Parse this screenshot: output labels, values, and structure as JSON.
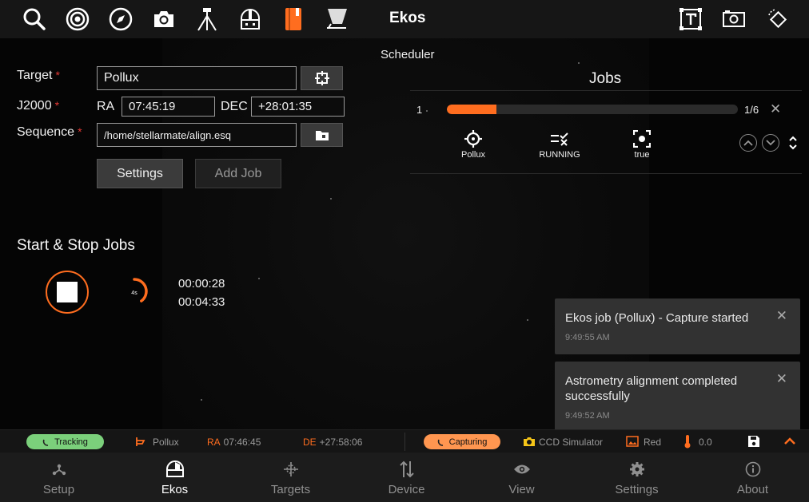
{
  "topbar": {
    "title": "Ekos",
    "icons": [
      "search-icon",
      "target-icon",
      "compass-icon",
      "camera-icon",
      "tripod-icon",
      "observatory-icon",
      "notebook-icon",
      "flat-panel-icon",
      "text-tool-icon",
      "frame-icon",
      "rotate-icon"
    ]
  },
  "scheduler": {
    "label": "Scheduler",
    "target_label": "Target",
    "target_value": "Pollux",
    "j2000_label": "J2000",
    "ra_label": "RA",
    "ra_value": "07:45:19",
    "dec_label": "DEC",
    "dec_value": "+28:01:35",
    "sequence_label": "Sequence",
    "sequence_value": "/home/stellarmate/align.esq",
    "required_marker": "*",
    "settings_button": "Settings",
    "add_job_button": "Add Job"
  },
  "start_stop": {
    "title": "Start & Stop Jobs",
    "countdown_label": "4s",
    "countdown_fraction": 0.4,
    "elapsed": "00:00:28",
    "remaining": "00:04:33"
  },
  "jobs": {
    "title": "Jobs",
    "items": [
      {
        "index": "1",
        "progress": 0.17,
        "count": "1/6",
        "target": "Pollux",
        "status": "RUNNING",
        "flag": "true"
      }
    ]
  },
  "toasts": [
    {
      "message": "Ekos job (Pollux) - Capture started",
      "time": "9:49:55 AM"
    },
    {
      "message": "Astrometry alignment completed successfully",
      "time": "9:49:52 AM"
    }
  ],
  "statusbar": {
    "mount_status": "Tracking",
    "mount_status_color": "#7bd07b",
    "target": "Pollux",
    "ra_key": "RA",
    "ra_value": "07:46:45",
    "de_key": "DE",
    "de_value": "+27:58:06",
    "capture_status": "Capturing",
    "capture_status_color": "#ff9650",
    "camera": "CCD Simulator",
    "filter": "Red",
    "temperature": "0.0"
  },
  "bottomnav": {
    "items": [
      {
        "label": "Setup",
        "icon": "setup-icon"
      },
      {
        "label": "Ekos",
        "icon": "ekos-dome-icon"
      },
      {
        "label": "Targets",
        "icon": "targets-icon"
      },
      {
        "label": "Device",
        "icon": "device-icon"
      },
      {
        "label": "View",
        "icon": "eye-icon"
      },
      {
        "label": "Settings",
        "icon": "gear-icon"
      },
      {
        "label": "About",
        "icon": "info-icon"
      }
    ],
    "active": "Ekos"
  },
  "colors": {
    "accent": "#ff6d1f",
    "required": "#e53935"
  }
}
